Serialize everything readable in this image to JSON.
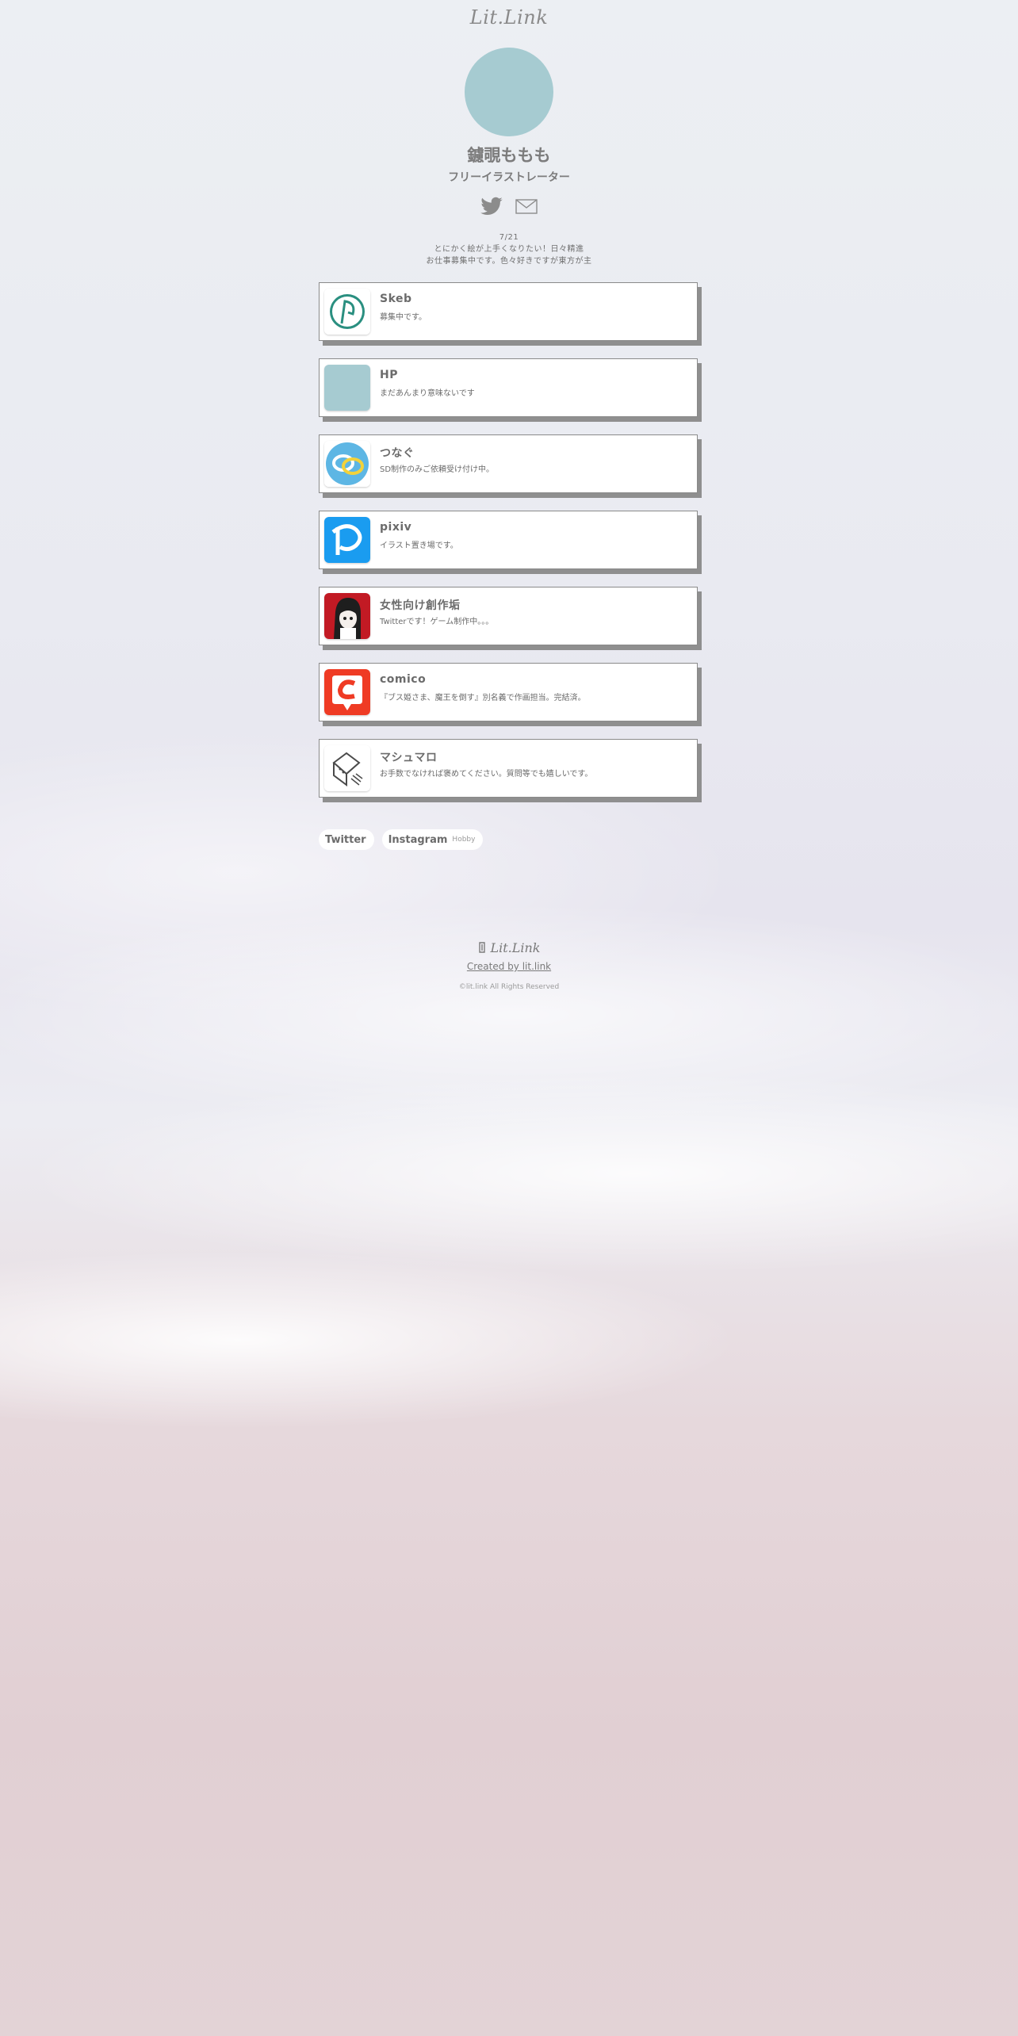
{
  "brand": {
    "name": "Lit.Link"
  },
  "profile": {
    "name": "鑢覗ももも",
    "subtitle": "フリーイラストレーター",
    "bio": [
      "7/21",
      "とにかく絵が上手くなりたい！日々精進",
      "お仕事募集中です。色々好きですが東方が主"
    ]
  },
  "social": {
    "icons": [
      "twitter-bird-icon",
      "mail-envelope-icon"
    ]
  },
  "links": [
    {
      "title": "Skeb",
      "desc": "募集中です。",
      "icon": "skeb-icon"
    },
    {
      "title": "HP",
      "desc": "まだあんまり意味ないです",
      "icon": "placeholder-square-icon"
    },
    {
      "title": "つなぐ",
      "desc": "SD制作のみご依頼受け付け中。",
      "icon": "tsunagu-icon"
    },
    {
      "title": "pixiv",
      "desc": "イラスト置き場です。",
      "icon": "pixiv-icon"
    },
    {
      "title": "女性向け創作垢",
      "desc": "Twitterです！ゲーム制作中。。。",
      "icon": "anime-avatar-icon"
    },
    {
      "title": "comico",
      "desc": "『ブス姫さま、魔王を倒す』別名義で作画担当。完結済。",
      "icon": "comico-icon"
    },
    {
      "title": "マシュマロ",
      "desc": "お手数でなければ褒めてください。質問等でも嬉しいです。",
      "icon": "marshmallow-icon"
    }
  ],
  "tags": [
    {
      "label": "Twitter",
      "sub": ""
    },
    {
      "label": "Instagram",
      "sub": "Hobby"
    }
  ],
  "footer": {
    "logo": "Lit.Link",
    "created": "Created by lit.link",
    "copyright": "©lit.link All Rights Reserved"
  },
  "colors": {
    "avatar": "#a6cbd1",
    "card_shadow": "#8f8f8f",
    "text": "#6f6f6f"
  }
}
